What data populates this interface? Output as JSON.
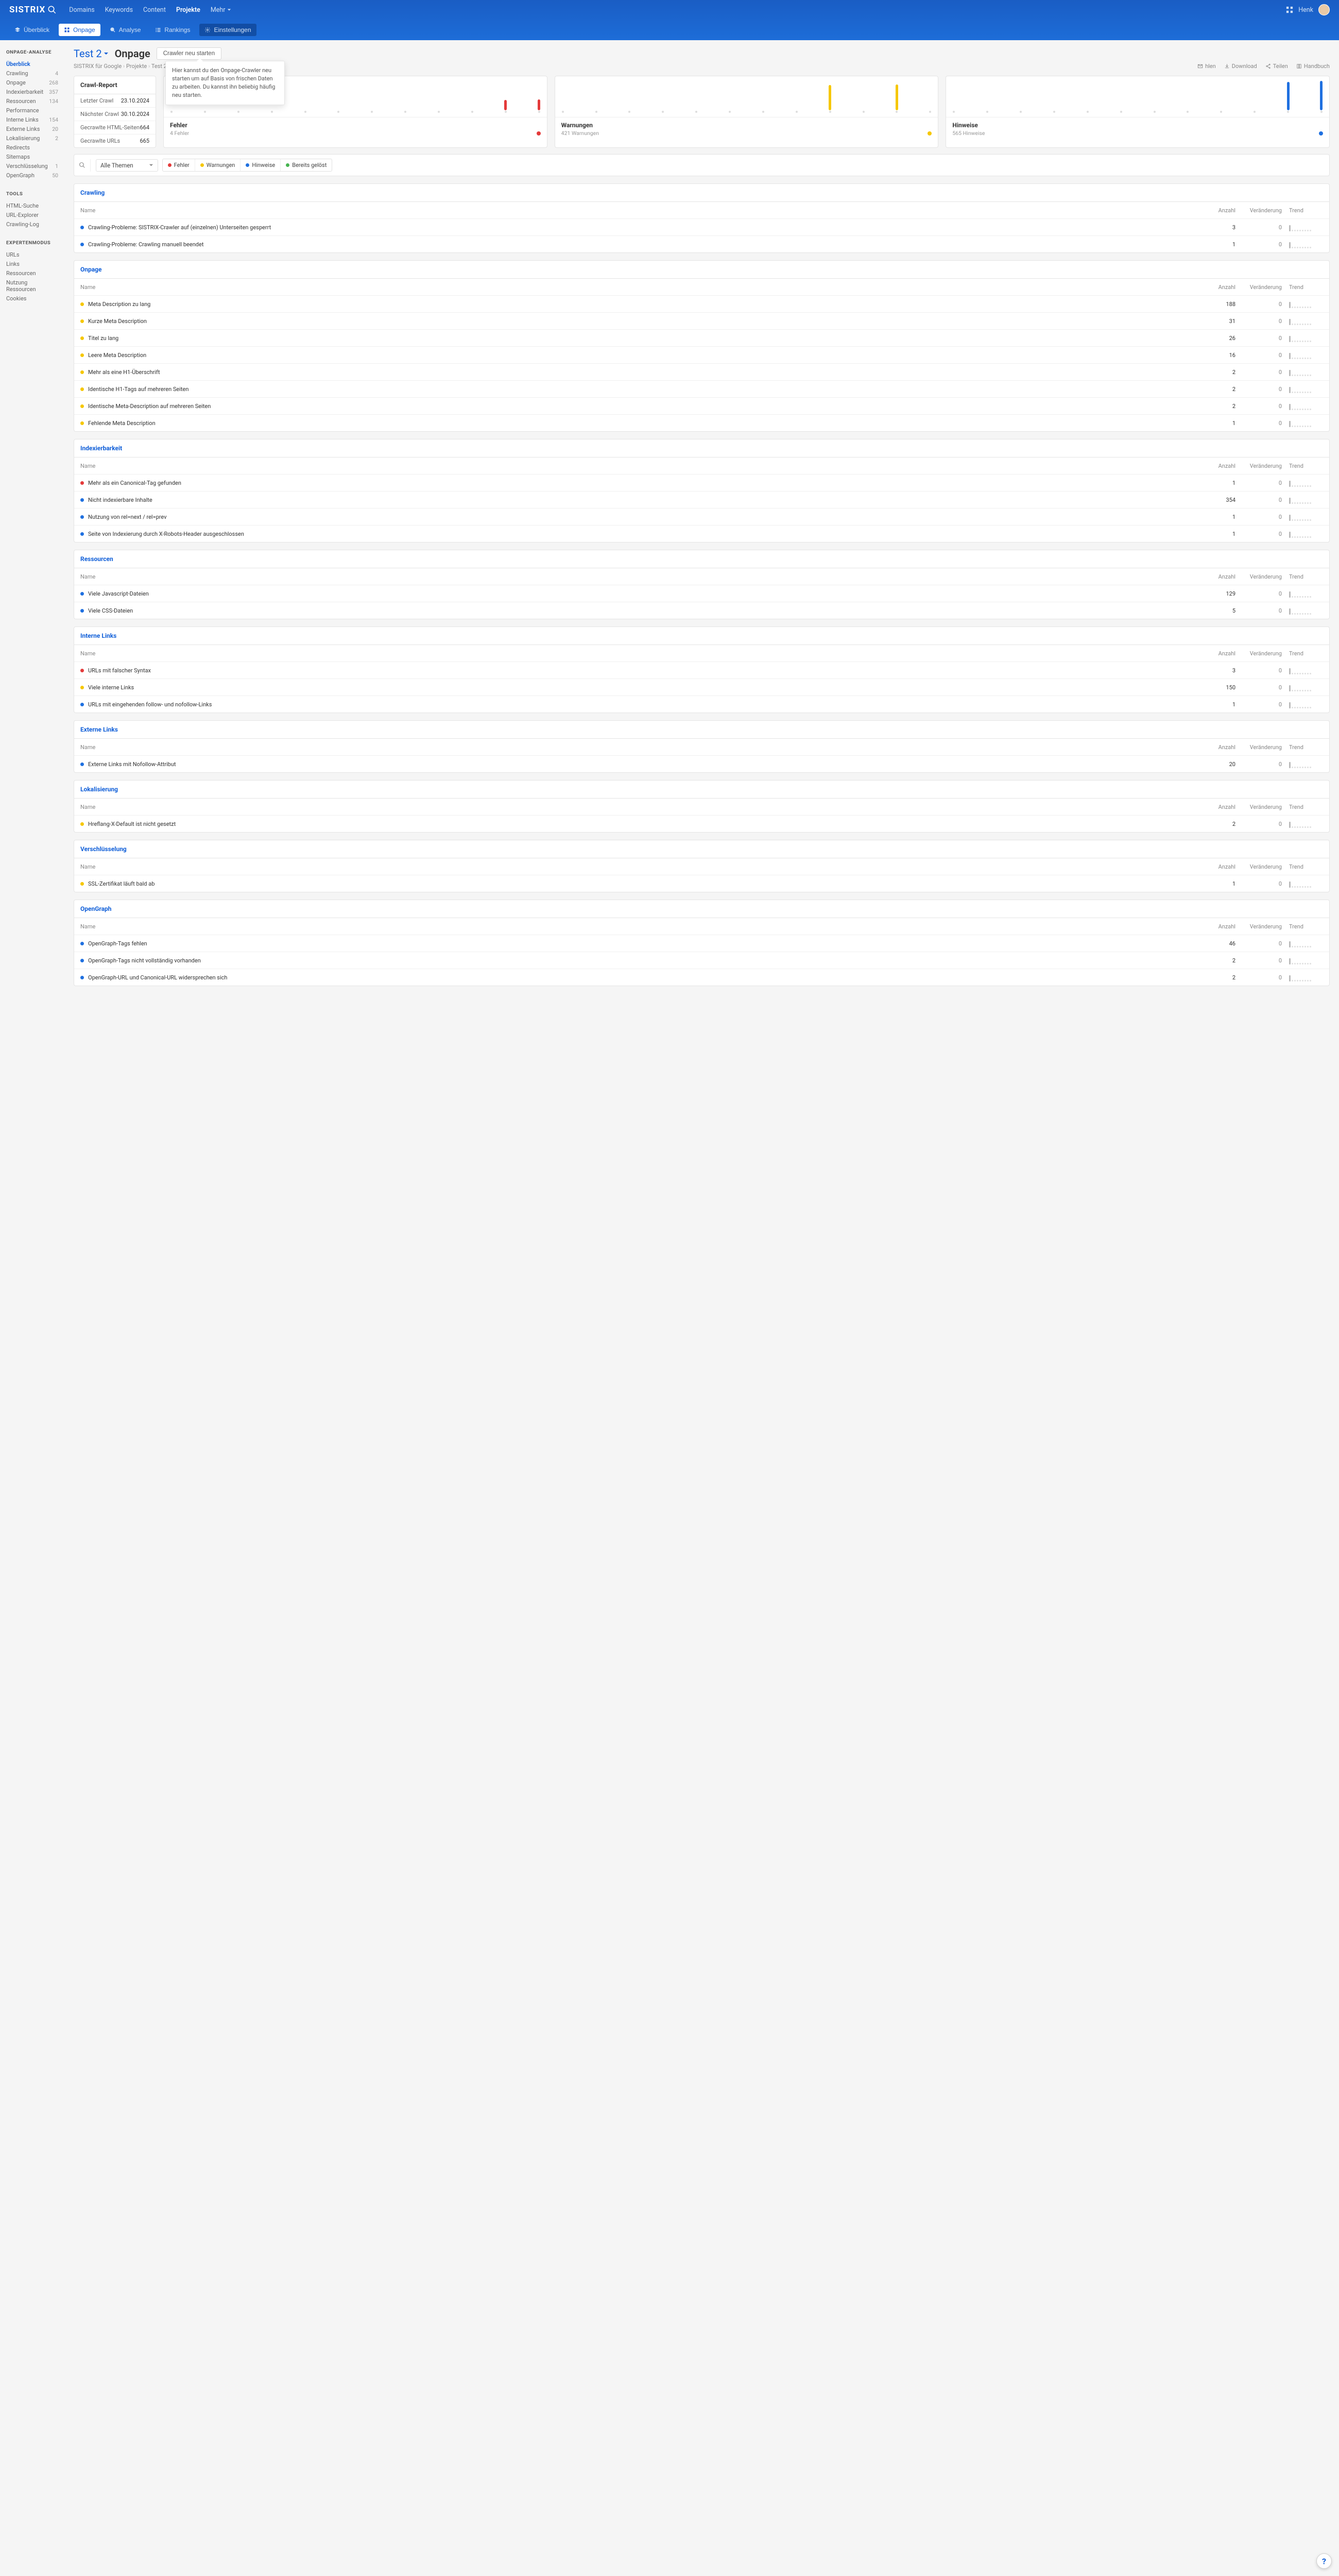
{
  "header": {
    "logo": "SISTRIX",
    "nav": [
      {
        "label": "Domains",
        "active": false
      },
      {
        "label": "Keywords",
        "active": false
      },
      {
        "label": "Content",
        "active": false
      },
      {
        "label": "Projekte",
        "active": true
      },
      {
        "label": "Mehr",
        "active": false
      }
    ],
    "user": "Henk",
    "subnav": [
      {
        "icon": "layers",
        "label": "Überblick",
        "style": "plain"
      },
      {
        "icon": "grid",
        "label": "Onpage",
        "style": "light"
      },
      {
        "icon": "search",
        "label": "Analyse",
        "style": "plain"
      },
      {
        "icon": "list",
        "label": "Rankings",
        "style": "plain"
      },
      {
        "icon": "gear",
        "label": "Einstellungen",
        "style": "dark"
      }
    ]
  },
  "sidebar": {
    "onpage": {
      "title": "ONPAGE-ANALYSE",
      "items": [
        {
          "label": "Überblick",
          "count": "",
          "active": true
        },
        {
          "label": "Crawling",
          "count": "4"
        },
        {
          "label": "Onpage",
          "count": "268"
        },
        {
          "label": "Indexierbarkeit",
          "count": "357"
        },
        {
          "label": "Ressourcen",
          "count": "134"
        },
        {
          "label": "Performance",
          "count": ""
        },
        {
          "label": "Interne Links",
          "count": "154"
        },
        {
          "label": "Externe Links",
          "count": "20"
        },
        {
          "label": "Lokalisierung",
          "count": "2"
        },
        {
          "label": "Redirects",
          "count": ""
        },
        {
          "label": "Sitemaps",
          "count": ""
        },
        {
          "label": "Verschlüsselung",
          "count": "1"
        },
        {
          "label": "OpenGraph",
          "count": "50"
        }
      ]
    },
    "tools": {
      "title": "TOOLS",
      "items": [
        {
          "label": "HTML-Suche"
        },
        {
          "label": "URL-Explorer"
        },
        {
          "label": "Crawling-Log"
        }
      ]
    },
    "expert": {
      "title": "EXPERTENMODUS",
      "items": [
        {
          "label": "URLs"
        },
        {
          "label": "Links"
        },
        {
          "label": "Ressourcen"
        },
        {
          "label": "Nutzung Ressourcen"
        },
        {
          "label": "Cookies"
        }
      ]
    }
  },
  "title": {
    "project": "Test 2",
    "page": "Onpage",
    "button": "Crawler neu starten",
    "tooltip": "Hier kannst du den Onpage-Crawler neu starten um auf Basis von frischen Daten zu arbeiten. Du kannst ihn beliebig häufig neu starten."
  },
  "breadcrumb": {
    "items": [
      "SISTRIX für Google",
      "Projekte",
      "Test 2",
      ""
    ],
    "actions": [
      {
        "icon": "mail",
        "label": "hlen"
      },
      {
        "icon": "download",
        "label": "Download"
      },
      {
        "icon": "share",
        "label": "Teilen"
      },
      {
        "icon": "book",
        "label": "Handbuch"
      }
    ]
  },
  "report": {
    "title": "Crawl-Report",
    "rows": [
      {
        "k": "Letzter Crawl",
        "v": "23.10.2024"
      },
      {
        "k": "Nächster Crawl",
        "v": "30.10.2024"
      },
      {
        "k": "Gecrawlte HTML-Seiten",
        "v": "664"
      },
      {
        "k": "Gecrawlte URLs",
        "v": "665"
      }
    ]
  },
  "chart_data": [
    {
      "type": "bar",
      "title": "Fehler",
      "subtitle": "4 Fehler",
      "color": "#e43a3a",
      "bars": [
        0,
        0,
        0,
        0,
        0,
        0,
        0,
        0,
        0,
        0,
        28,
        30
      ]
    },
    {
      "type": "bar",
      "title": "Warnungen",
      "subtitle": "421 Warnungen",
      "color": "#f6c700",
      "bars": [
        0,
        0,
        0,
        0,
        0,
        0,
        0,
        0,
        70,
        0,
        72,
        0
      ]
    },
    {
      "type": "bar",
      "title": "Hinweise",
      "subtitle": "565 Hinweise",
      "color": "#1f70e0",
      "bars": [
        0,
        0,
        0,
        0,
        0,
        0,
        0,
        0,
        0,
        0,
        78,
        82
      ]
    }
  ],
  "filters": {
    "select": "Alle Themen",
    "chips": [
      {
        "color": "red",
        "label": "Fehler"
      },
      {
        "color": "yellow",
        "label": "Warnungen"
      },
      {
        "color": "blue",
        "label": "Hinweise"
      },
      {
        "color": "green",
        "label": "Bereits gelöst"
      }
    ]
  },
  "labels": {
    "name": "Name",
    "count": "Anzahl",
    "change": "Veränderung",
    "trend": "Trend"
  },
  "sections": [
    {
      "title": "Crawling",
      "rows": [
        {
          "color": "blue",
          "name": "Crawling-Probleme: SISTRIX-Crawler auf (einzelnen) Unterseiten gesperrt",
          "count": "3",
          "change": "0"
        },
        {
          "color": "blue",
          "name": "Crawling-Probleme: Crawling manuell beendet",
          "count": "1",
          "change": "0"
        }
      ]
    },
    {
      "title": "Onpage",
      "rows": [
        {
          "color": "yellow",
          "name": "Meta Description zu lang",
          "count": "188",
          "change": "0"
        },
        {
          "color": "yellow",
          "name": "Kurze Meta Description",
          "count": "31",
          "change": "0"
        },
        {
          "color": "yellow",
          "name": "Titel zu lang",
          "count": "26",
          "change": "0"
        },
        {
          "color": "yellow",
          "name": "Leere Meta Description",
          "count": "16",
          "change": "0"
        },
        {
          "color": "yellow",
          "name": "Mehr als eine H1-Überschrift",
          "count": "2",
          "change": "0"
        },
        {
          "color": "yellow",
          "name": "Identische H1-Tags auf mehreren Seiten",
          "count": "2",
          "change": "0"
        },
        {
          "color": "yellow",
          "name": "Identische Meta-Description auf mehreren Seiten",
          "count": "2",
          "change": "0"
        },
        {
          "color": "yellow",
          "name": "Fehlende Meta Description",
          "count": "1",
          "change": "0"
        }
      ]
    },
    {
      "title": "Indexierbarkeit",
      "rows": [
        {
          "color": "red",
          "name": "Mehr als ein Canonical-Tag gefunden",
          "count": "1",
          "change": "0"
        },
        {
          "color": "blue",
          "name": "Nicht indexierbare Inhalte",
          "count": "354",
          "change": "0"
        },
        {
          "color": "blue",
          "name": "Nutzung von rel=next / rel=prev",
          "count": "1",
          "change": "0"
        },
        {
          "color": "blue",
          "name": "Seite von Indexierung durch X-Robots-Header ausgeschlossen",
          "count": "1",
          "change": "0"
        }
      ]
    },
    {
      "title": "Ressourcen",
      "rows": [
        {
          "color": "blue",
          "name": "Viele Javascript-Dateien",
          "count": "129",
          "change": "0"
        },
        {
          "color": "blue",
          "name": "Viele CSS-Dateien",
          "count": "5",
          "change": "0"
        }
      ]
    },
    {
      "title": "Interne Links",
      "rows": [
        {
          "color": "red",
          "name": "URLs mit falscher Syntax",
          "count": "3",
          "change": "0"
        },
        {
          "color": "yellow",
          "name": "Viele interne Links",
          "count": "150",
          "change": "0"
        },
        {
          "color": "blue",
          "name": "URLs mit eingehenden follow- und nofollow-Links",
          "count": "1",
          "change": "0"
        }
      ]
    },
    {
      "title": "Externe Links",
      "rows": [
        {
          "color": "blue",
          "name": "Externe Links mit Nofollow-Attribut",
          "count": "20",
          "change": "0"
        }
      ]
    },
    {
      "title": "Lokalisierung",
      "rows": [
        {
          "color": "yellow",
          "name": "Hreflang-X-Default ist nicht gesetzt",
          "count": "2",
          "change": "0"
        }
      ]
    },
    {
      "title": "Verschlüsselung",
      "rows": [
        {
          "color": "yellow",
          "name": "SSL-Zertifikat läuft bald ab",
          "count": "1",
          "change": "0"
        }
      ]
    },
    {
      "title": "OpenGraph",
      "rows": [
        {
          "color": "blue",
          "name": "OpenGraph-Tags fehlen",
          "count": "46",
          "change": "0"
        },
        {
          "color": "blue",
          "name": "OpenGraph-Tags nicht vollständig vorhanden",
          "count": "2",
          "change": "0"
        },
        {
          "color": "blue",
          "name": "OpenGraph-URL und Canonical-URL widersprechen sich",
          "count": "2",
          "change": "0"
        }
      ]
    }
  ],
  "help": "?"
}
